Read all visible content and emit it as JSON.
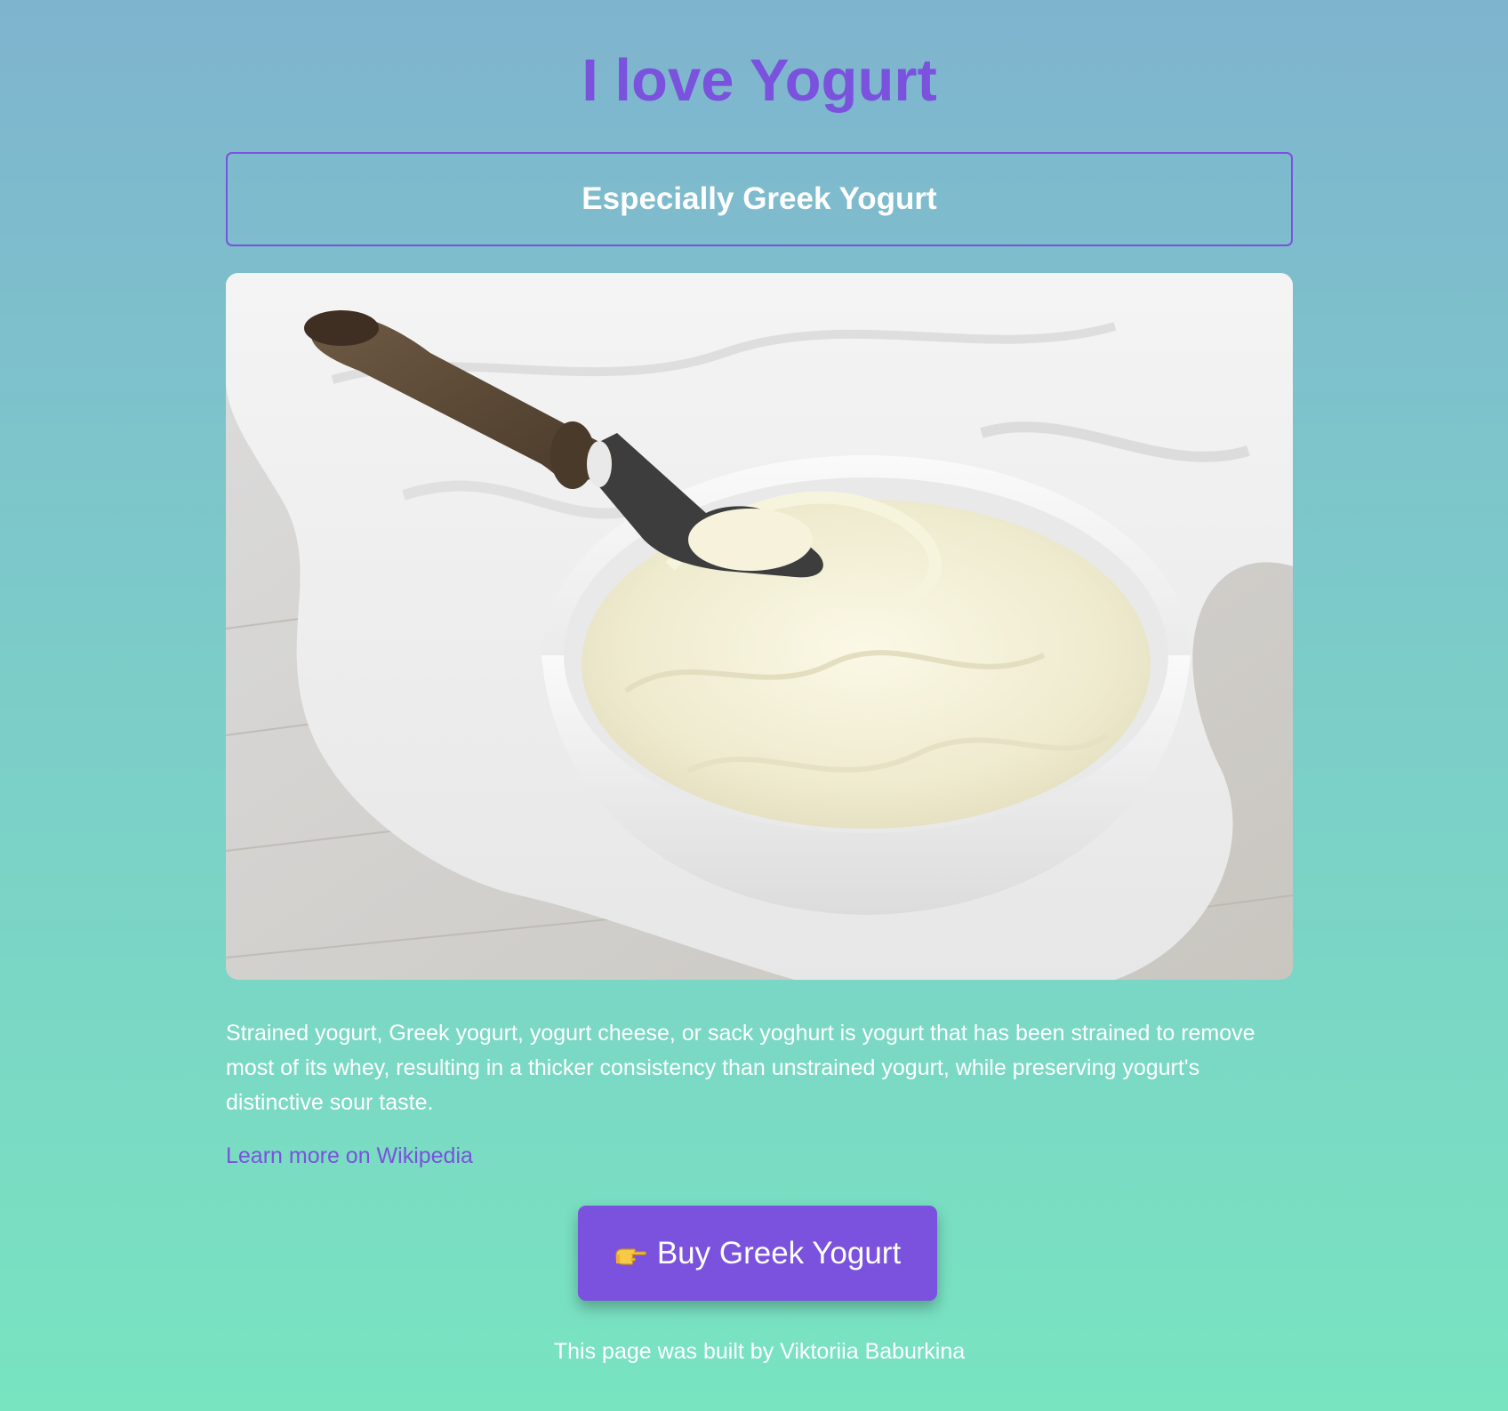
{
  "header": {
    "title": "I love Yogurt",
    "subtitle": "Especially Greek Yogurt"
  },
  "main": {
    "image_alt": "Bowl of Greek yogurt with a vintage spoon",
    "description": "Strained yogurt, Greek yogurt, yogurt cheese, or sack yoghurt is yogurt that has been strained to remove most of its whey, resulting in a thicker consistency than unstrained yogurt, while preserving yogurt's distinctive sour taste.",
    "link_label": "Learn more on Wikipedia",
    "button_icon": "pointing-hand-icon",
    "button_label": "Buy Greek Yogurt"
  },
  "footer": {
    "text": "This page was built by Viktoriia Baburkina"
  },
  "colors": {
    "accent": "#7a52dd",
    "text": "#ffffff",
    "gradient_top": "#7fb4cf",
    "gradient_bottom": "#78e4c0"
  }
}
